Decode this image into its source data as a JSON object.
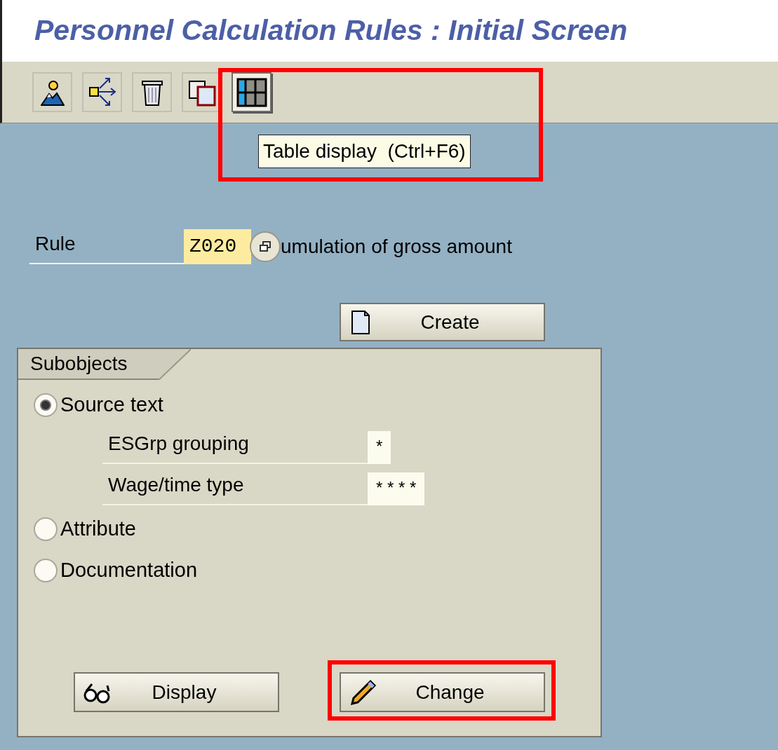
{
  "window": {
    "title": "Personnel Calculation Rules : Initial Screen"
  },
  "toolbar": [
    {
      "kind": "picture",
      "pressed": false
    },
    {
      "kind": "distribute",
      "pressed": false
    },
    {
      "kind": "trash",
      "pressed": false
    },
    {
      "kind": "copy",
      "pressed": false
    },
    {
      "kind": "table",
      "pressed": true
    }
  ],
  "tooltip": {
    "text": "Table display  (Ctrl+F6)",
    "highlighted": true
  },
  "rule": {
    "label": "Rule",
    "value": "Z020",
    "description": "umulation of gross amount"
  },
  "create_button": {
    "label": "Create"
  },
  "subobjects": {
    "tab": "Subobjects",
    "options": [
      {
        "label": "Source text",
        "selected": true,
        "fields": [
          {
            "label": "ESGrp grouping",
            "value": "*"
          },
          {
            "label": "Wage/time type",
            "value": "* * * *"
          }
        ]
      },
      {
        "label": "Attribute",
        "selected": false
      },
      {
        "label": "Documentation",
        "selected": false
      }
    ]
  },
  "buttons": [
    {
      "kind": "display",
      "label": "Display",
      "highlighted": false
    },
    {
      "kind": "change",
      "label": "Change",
      "highlighted": true
    }
  ]
}
